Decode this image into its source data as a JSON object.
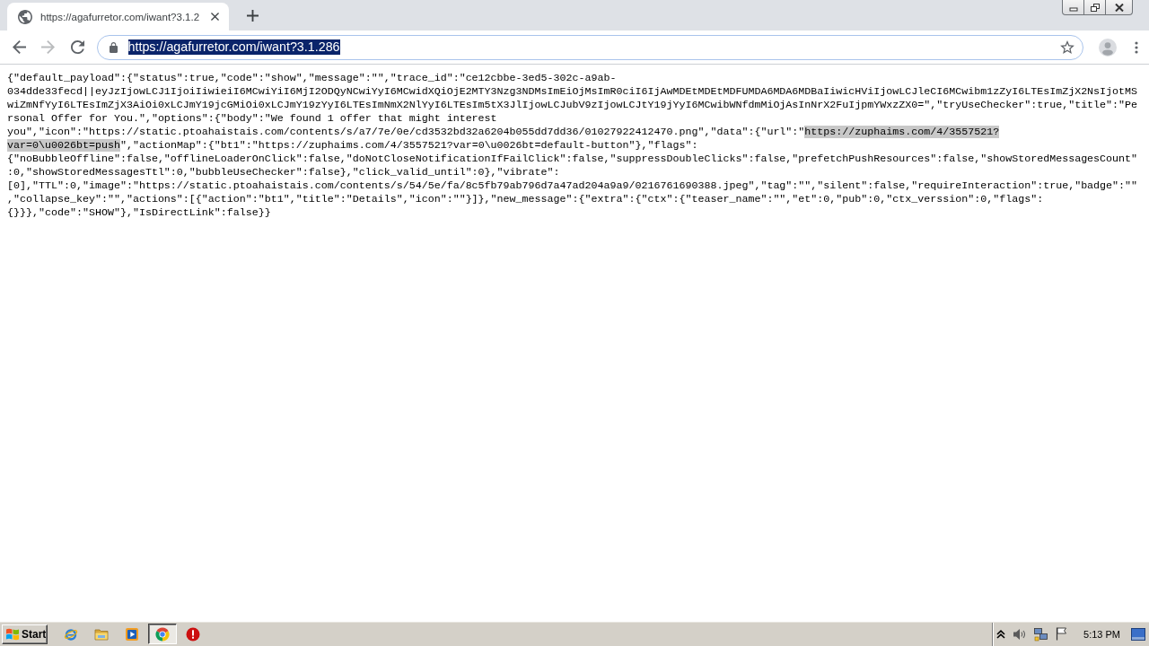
{
  "tabs": [
    {
      "title": "https://agafurretor.com/iwant?3.1.2",
      "selected": true
    }
  ],
  "nav_buttons": [
    {
      "kind": "back",
      "disabled": false
    },
    {
      "kind": "forward",
      "disabled": true
    },
    {
      "kind": "reload",
      "disabled": false
    }
  ],
  "address_bar": {
    "value": "https://agafurretor.com/iwant?3.1.286",
    "selected": true
  },
  "page_text": {
    "lines": [
      {
        "segments": [
          {
            "text": "{\"default_payload\":{\"status\":true,\"code\":\"show\",\"message\":\"\",\"trace_id\":\"ce12cbbe-3ed5-302c-a9ab-",
            "selected": false
          }
        ]
      },
      {
        "segments": [
          {
            "text": "034dde33fecd||eyJzIjowLCJ1IjoiIiwieiI6MCwiYiI6MjI2ODQyNCwiYyI6MCwidXQiOjE2MTY3Nzg3NDMsImEiOjMsImR0ciI6IjAwMDEtMDEtMDFUMDA6MDA6MDBaIiwicHViIjowLCJleCI6MCwibm1zZyI6LTEsImZjX2NsIjotMS",
            "selected": false
          }
        ]
      },
      {
        "segments": [
          {
            "text": "wiZmNfYyI6LTEsImZjX3AiOi0xLCJmY19jcGMiOi0xLCJmY19zYyI6LTEsImNmX2NlYyI6LTEsIm5tX3JlIjowLCJubV9zIjowLCJtY19jYyI6MCwibWNfdmMiOjAsInNrX2FuIjpmYWxzZX0=\",\"tryUseChecker\":true,\"title\":\"Pe",
            "selected": false
          }
        ]
      },
      {
        "segments": [
          {
            "text": "rsonal Offer for You.\",\"options\":{\"body\":\"We found 1 offer that might interest",
            "selected": false
          }
        ]
      },
      {
        "segments": [
          {
            "text": "you\",\"icon\":\"https://static.ptoahaistais.com/contents/s/a7/7e/0e/cd3532bd32a6204b055dd7dd36/01027922412470.png\",\"data\":{\"url\":\"",
            "selected": false
          },
          {
            "text": "https://zuphaims.com/4/3557521?",
            "selected": true
          }
        ]
      },
      {
        "segments": [
          {
            "text": "var=0\\u0026bt=push",
            "selected": true
          },
          {
            "text": "\",\"actionMap\":{\"bt1\":\"https://zuphaims.com/4/3557521?var=0\\u0026bt=default-button\"},\"flags\":",
            "selected": false
          }
        ]
      },
      {
        "segments": [
          {
            "text": "{\"noBubbleOffline\":false,\"offlineLoaderOnClick\":false,\"doNotCloseNotificationIfFailClick\":false,\"suppressDoubleClicks\":false,\"prefetchPushResources\":false,\"showStoredMessagesCount\"",
            "selected": false
          }
        ]
      },
      {
        "segments": [
          {
            "text": ":0,\"showStoredMessagesTtl\":0,\"bubbleUseChecker\":false},\"click_valid_until\":0},\"vibrate\":",
            "selected": false
          }
        ]
      },
      {
        "segments": [
          {
            "text": "[0],\"TTL\":0,\"image\":\"https://static.ptoahaistais.com/contents/s/54/5e/fa/8c5fb79ab796d7a47ad204a9a9/0216761690388.jpeg\",\"tag\":\"\",\"silent\":false,\"requireInteraction\":true,\"badge\":\"\"",
            "selected": false
          }
        ]
      },
      {
        "segments": [
          {
            "text": ",\"collapse_key\":\"\",\"actions\":[{\"action\":\"bt1\",\"title\":\"Details\",\"icon\":\"\"}]},\"new_message\":{\"extra\":{\"ctx\":{\"teaser_name\":\"\",\"et\":0,\"pub\":0,\"ctx_verssion\":0,\"flags\":",
            "selected": false
          }
        ]
      },
      {
        "segments": [
          {
            "text": "{}}},\"code\":\"SHOW\"},\"IsDirectLink\":false}}",
            "selected": false
          }
        ]
      }
    ]
  },
  "taskbar": {
    "start_label": "Start",
    "apps": [
      {
        "kind": "orbit",
        "selected": false
      },
      {
        "kind": "folder",
        "selected": false
      },
      {
        "kind": "player",
        "selected": false
      },
      {
        "kind": "circle-logo",
        "selected": true
      },
      {
        "kind": "exclamation",
        "selected": false
      }
    ],
    "clock": "5:13 PM"
  }
}
